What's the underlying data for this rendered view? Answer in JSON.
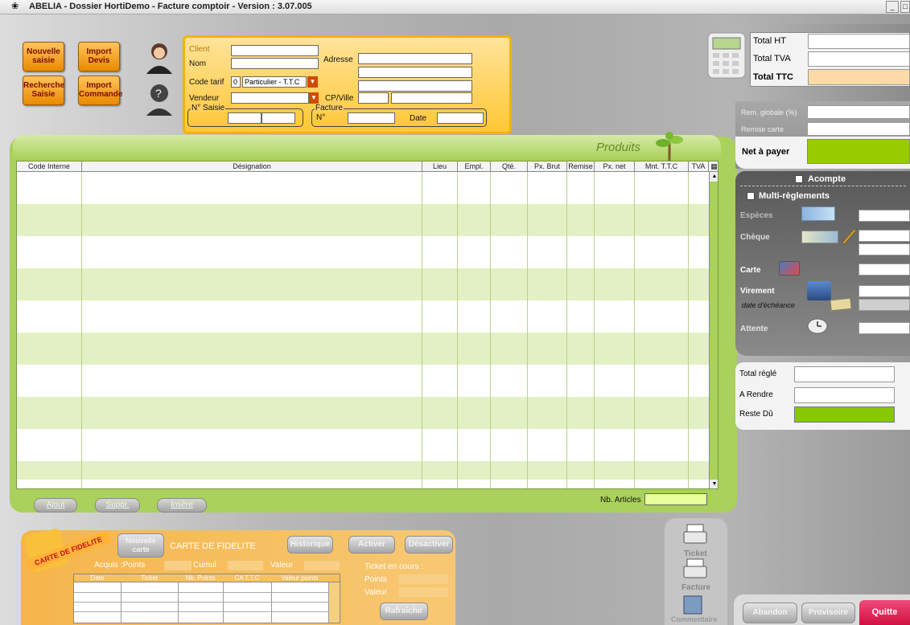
{
  "window": {
    "title": "ABELIA  -  Dossier HortiDemo  -  Facture comptoir  -  Version : 3.07.005"
  },
  "actions": {
    "nouvelle_saisie": "Nouvelle saisie",
    "import_devis": "Import Devis",
    "recherche_saisie": "Recherche Saisie",
    "import_commande": "Import Commande"
  },
  "client": {
    "client_label": "Client",
    "nom_label": "Nom",
    "adresse_label": "Adresse",
    "code_tarif_label": "Code tarif",
    "code_tarif_code": "0",
    "code_tarif_value": "Particulier - T.T.C",
    "vendeur_label": "Vendeur",
    "cpville_label": "CP/Ville",
    "nsaisie_label": "N° Saisie",
    "facture_label": "Facture",
    "facture_n_label": "N°",
    "date_label": "Date"
  },
  "produits": {
    "title": "Produits",
    "columns": [
      "Code Interne",
      "Désignation",
      "Lieu",
      "Empl.",
      "Qté.",
      "Px. Brut",
      "Remise",
      "Px. net",
      "Mnt. T.T.C",
      "TVA"
    ],
    "nb_articles_label": "Nb. Articles"
  },
  "grid_buttons": {
    "ajout": "Ajout",
    "suppr": "Suppr.",
    "insere": "Insère"
  },
  "totals": {
    "total_ht": "Total HT",
    "total_tva": "Total TVA",
    "total_ttc": "Total TTC",
    "rem_globale": "Rem. globale (%)",
    "remise_carte": "Remise carte",
    "net_a_payer": "Net à payer"
  },
  "payment": {
    "acompte": "Acompte",
    "multi": "Multi-règlements",
    "especes": "Espèces",
    "cheque": "Chèque",
    "carte": "Carte",
    "virement": "Virement",
    "date_echeance": "date d'échéance",
    "attente": "Attente"
  },
  "summary": {
    "total_regle": "Total réglé",
    "a_rendre": "A Rendre",
    "reste_du": "Reste Dû"
  },
  "bottom_buttons": {
    "abandon": "Abandon",
    "provisoire": "Provisoire",
    "quitte": "Quitte"
  },
  "print": {
    "ticket": "Ticket",
    "facture": "Facture",
    "commentaire": "Commentaire"
  },
  "fidelite": {
    "badge": "CARTE DE FIDELITE",
    "nouvelle_carte": "Nouvelle carte",
    "title": "CARTE DE FIDELITE",
    "historique": "Historique",
    "activer": "Activer",
    "desactiver": "Désactiver",
    "acquis_points": "Acquis :Points",
    "cumul": "Cumul",
    "valeur": "Valeur",
    "ticket_en_cours": "Ticket en cours :",
    "points": "Points",
    "valeur2": "Valeur",
    "rafraichir": "Rafraîchir",
    "columns": [
      "Date",
      "Ticket",
      "Nb. Points",
      "CA T.T.C",
      "Valeur points"
    ]
  },
  "colors": {
    "accent_green": "#99cc00",
    "panel_green": "#a9d15b",
    "orange": "#f5b54c",
    "quit_red": "#e8194f"
  }
}
